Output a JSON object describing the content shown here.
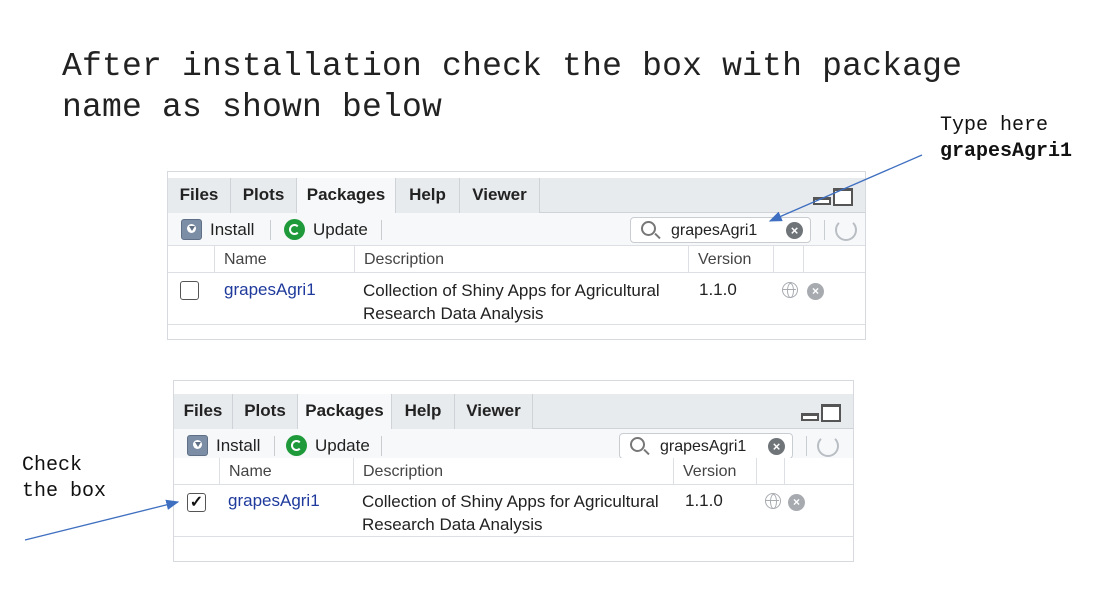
{
  "heading": "After installation check the box with package\nname as shown below",
  "note_type": {
    "line1": "Type here",
    "line2": "grapesAgri1"
  },
  "note_check": {
    "line1": "Check",
    "line2": "the box"
  },
  "panels": [
    {
      "tabs": [
        "Files",
        "Plots",
        "Packages",
        "Help",
        "Viewer"
      ],
      "active_tab": "Packages",
      "toolbar": {
        "install": "Install",
        "update": "Update"
      },
      "search": {
        "value": "grapesAgri1",
        "clear_icon": "clear-icon"
      },
      "columns": [
        "Name",
        "Description",
        "Version"
      ],
      "row": {
        "checked": false,
        "name": "grapesAgri1",
        "description": "Collection of Shiny Apps for Agricultural Research Data Analysis",
        "version": "1.1.0"
      }
    },
    {
      "tabs": [
        "Files",
        "Plots",
        "Packages",
        "Help",
        "Viewer"
      ],
      "active_tab": "Packages",
      "toolbar": {
        "install": "Install",
        "update": "Update"
      },
      "search": {
        "value": "grapesAgri1",
        "clear_icon": "clear-icon"
      },
      "columns": [
        "Name",
        "Description",
        "Version"
      ],
      "row": {
        "checked": true,
        "check_mark": "✓",
        "name": "grapesAgri1",
        "description": "Collection of Shiny Apps for Agricultural Research Data Analysis",
        "version": "1.1.0"
      }
    }
  ],
  "colors": {
    "link": "#1f3a9c",
    "update_green": "#1f9a3b",
    "arrow": "#3f6fc0"
  }
}
